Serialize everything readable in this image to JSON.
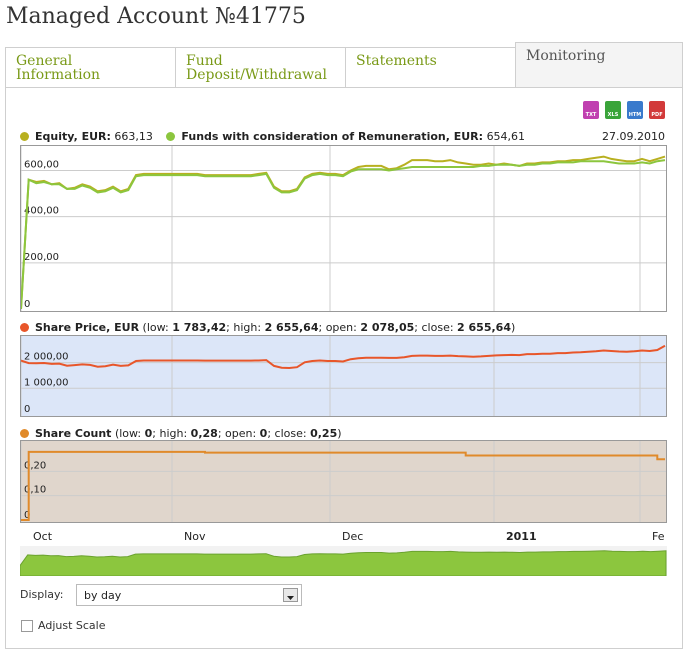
{
  "page_title": "Managed Account №41775",
  "tabs": [
    {
      "line1": "General",
      "line2": "Information",
      "active": false
    },
    {
      "line1": "Fund",
      "line2": "Deposit/Withdrawal",
      "active": false
    },
    {
      "line1": "Statements",
      "line2": "",
      "active": false
    },
    {
      "line1": "Monitoring",
      "line2": "",
      "active": true
    }
  ],
  "export_buttons": [
    {
      "label": "TXT",
      "color": "#c040b0",
      "icon": "txt-export-icon"
    },
    {
      "label": "XLS",
      "color": "#3aa43a",
      "icon": "xls-export-icon"
    },
    {
      "label": "HTM",
      "color": "#3a7acc",
      "icon": "htm-export-icon"
    },
    {
      "label": "PDF",
      "color": "#d23a3a",
      "icon": "pdf-export-icon"
    }
  ],
  "legend1": {
    "equity_label": "Equity, EUR:",
    "equity_value": "663,13",
    "equity_color": "#b8b020",
    "funds_label": "Funds with consideration of Remuneration, EUR:",
    "funds_value": "654,61",
    "funds_color": "#8cc63e"
  },
  "date": "27.09.2010",
  "legend2": {
    "label": "Share Price, EUR",
    "open_paren": " (low: ",
    "low": "1 783,42",
    "high_label": "; high: ",
    "high": "2 655,64",
    "open_label": "; open: ",
    "open": "2 078,05",
    "close_label": "; close: ",
    "close": "2 655,64",
    "end": ")",
    "color": "#e8562a"
  },
  "legend3": {
    "label": "Share Count",
    "open_paren": " (low: ",
    "low": "0",
    "high_label": "; high: ",
    "high": "0,28",
    "open_label": "; open: ",
    "open": "0",
    "close_label": "; close: ",
    "close": "0,25",
    "end": ")",
    "color": "#e08a2a"
  },
  "colors": {
    "price_line": "#e8562a",
    "count_line": "#e08a2a",
    "price_bg": "#dce6f8",
    "count_bg": "#e0d6cc",
    "equity_line": "#b8b020",
    "funds_line": "#8cc63e",
    "navigator_fill": "#8cc63e"
  },
  "chart_data": [
    {
      "type": "line",
      "title": "",
      "ylim": [
        0,
        680
      ],
      "yticks": [
        "600,00",
        "400,00",
        "200,00",
        "0"
      ],
      "ytick_values": [
        600,
        400,
        200,
        0
      ],
      "x_ticks": [
        "Oct",
        "Nov",
        "Dec",
        "2011",
        "Fe"
      ],
      "series": [
        {
          "name": "Equity, EUR",
          "values": [
            0,
            560,
            550,
            555,
            540,
            545,
            520,
            525,
            540,
            530,
            510,
            515,
            530,
            510,
            520,
            580,
            585,
            585,
            585,
            585,
            585,
            585,
            585,
            585,
            580,
            580,
            580,
            580,
            580,
            580,
            580,
            585,
            590,
            530,
            510,
            510,
            520,
            570,
            585,
            590,
            585,
            585,
            580,
            600,
            615,
            620,
            620,
            620,
            605,
            610,
            625,
            645,
            645,
            645,
            640,
            640,
            645,
            635,
            630,
            625,
            625,
            630,
            625,
            630,
            625,
            620,
            630,
            630,
            635,
            635,
            640,
            640,
            645,
            645,
            650,
            655,
            660,
            650,
            645,
            640,
            640,
            650,
            640,
            650,
            660
          ]
        },
        {
          "name": "Funds with consideration of Remuneration, EUR",
          "values": [
            0,
            560,
            545,
            550,
            540,
            540,
            520,
            520,
            535,
            525,
            505,
            510,
            525,
            505,
            515,
            575,
            580,
            580,
            580,
            580,
            580,
            580,
            580,
            580,
            575,
            575,
            575,
            575,
            575,
            575,
            575,
            580,
            585,
            525,
            505,
            505,
            515,
            565,
            580,
            585,
            580,
            580,
            575,
            595,
            605,
            605,
            605,
            605,
            600,
            605,
            610,
            615,
            615,
            615,
            615,
            615,
            615,
            615,
            615,
            615,
            620,
            620,
            625,
            625,
            625,
            620,
            625,
            625,
            630,
            630,
            635,
            635,
            635,
            640,
            640,
            640,
            640,
            635,
            630,
            630,
            630,
            635,
            630,
            640,
            645
          ]
        }
      ]
    },
    {
      "type": "line",
      "title": "",
      "ylim": [
        0,
        2800
      ],
      "yticks": [
        "2 000,00",
        "1 000,00",
        "0"
      ],
      "ytick_values": [
        2000,
        1000,
        0
      ],
      "series": [
        {
          "name": "Share Price, EUR",
          "values": [
            2078,
            1980,
            1975,
            1985,
            1950,
            1960,
            1880,
            1900,
            1930,
            1910,
            1840,
            1860,
            1920,
            1870,
            1890,
            2060,
            2080,
            2080,
            2080,
            2080,
            2080,
            2080,
            2080,
            2080,
            2075,
            2075,
            2075,
            2075,
            2075,
            2075,
            2075,
            2080,
            2095,
            1870,
            1800,
            1790,
            1820,
            2010,
            2060,
            2080,
            2060,
            2060,
            2040,
            2130,
            2170,
            2190,
            2190,
            2190,
            2180,
            2180,
            2210,
            2260,
            2270,
            2270,
            2260,
            2260,
            2270,
            2250,
            2240,
            2230,
            2240,
            2260,
            2280,
            2290,
            2300,
            2290,
            2330,
            2330,
            2340,
            2340,
            2370,
            2370,
            2390,
            2400,
            2420,
            2440,
            2470,
            2450,
            2430,
            2420,
            2440,
            2470,
            2450,
            2490,
            2655
          ]
        }
      ]
    },
    {
      "type": "line",
      "title": "",
      "ylim": [
        0,
        0.3
      ],
      "yticks": [
        "0,20",
        "0,10",
        "0"
      ],
      "ytick_values": [
        0.2,
        0.1,
        0
      ],
      "series": [
        {
          "name": "Share Count",
          "values": [
            0,
            0.28,
            0.28,
            0.28,
            0.28,
            0.28,
            0.28,
            0.28,
            0.28,
            0.28,
            0.28,
            0.28,
            0.28,
            0.28,
            0.28,
            0.28,
            0.28,
            0.28,
            0.28,
            0.28,
            0.28,
            0.28,
            0.28,
            0.28,
            0.277,
            0.277,
            0.277,
            0.277,
            0.277,
            0.277,
            0.277,
            0.277,
            0.277,
            0.277,
            0.277,
            0.277,
            0.277,
            0.277,
            0.277,
            0.277,
            0.277,
            0.277,
            0.277,
            0.277,
            0.277,
            0.277,
            0.277,
            0.277,
            0.277,
            0.277,
            0.277,
            0.277,
            0.277,
            0.277,
            0.277,
            0.277,
            0.277,
            0.277,
            0.265,
            0.265,
            0.265,
            0.265,
            0.265,
            0.265,
            0.265,
            0.265,
            0.265,
            0.265,
            0.265,
            0.265,
            0.265,
            0.265,
            0.265,
            0.265,
            0.265,
            0.265,
            0.265,
            0.265,
            0.265,
            0.265,
            0.265,
            0.265,
            0.265,
            0.25,
            0.25
          ]
        }
      ]
    }
  ],
  "controls": {
    "display_label": "Display:",
    "display_value": "by day",
    "adjust_scale_label": "Adjust Scale",
    "adjust_scale_checked": false
  }
}
